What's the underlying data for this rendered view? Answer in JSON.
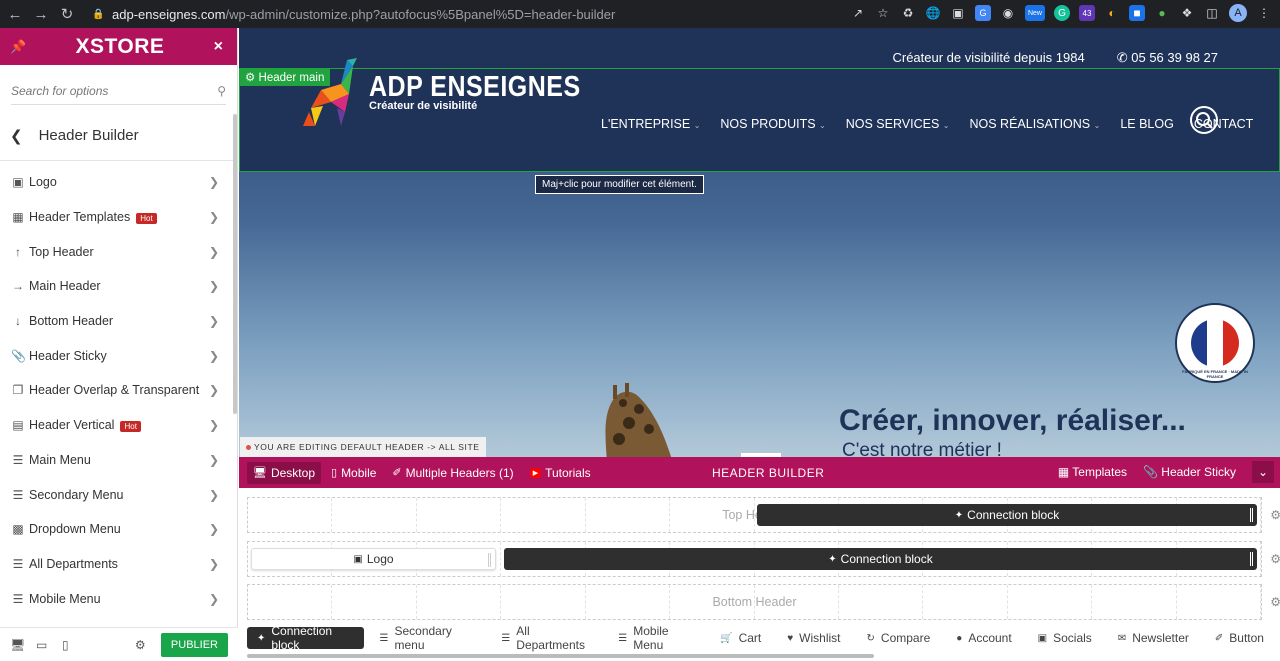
{
  "browser": {
    "url_host": "adp-enseignes.com",
    "url_path": "/wp-admin/customize.php?autofocus%5Bpanel%5D=header-builder",
    "profile_initial": "A",
    "ext_badge": "43",
    "new_badge": "New"
  },
  "sidebar": {
    "brand": "XSTORE",
    "search_placeholder": "Search for options",
    "panel_title": "Header Builder",
    "hot_label": "Hot",
    "items": [
      {
        "label": "Logo",
        "icon": "image-icon"
      },
      {
        "label": "Header Templates",
        "icon": "templates-icon",
        "hot": true
      },
      {
        "label": "Top Header",
        "icon": "arrow-up-icon"
      },
      {
        "label": "Main Header",
        "icon": "arrow-right-icon"
      },
      {
        "label": "Bottom Header",
        "icon": "arrow-down-icon"
      },
      {
        "label": "Header Sticky",
        "icon": "paperclip-icon"
      },
      {
        "label": "Header Overlap & Transparent",
        "icon": "layers-icon"
      },
      {
        "label": "Header Vertical",
        "icon": "document-icon",
        "hot": true
      },
      {
        "label": "Main Menu",
        "icon": "menu-icon"
      },
      {
        "label": "Secondary Menu",
        "icon": "menu-icon"
      },
      {
        "label": "Dropdown Menu",
        "icon": "dropdown-icon"
      },
      {
        "label": "All Departments",
        "icon": "menu-icon"
      },
      {
        "label": "Mobile Menu",
        "icon": "menu-icon"
      }
    ],
    "publish_label": "PUBLIER"
  },
  "preview": {
    "tagline": "Créateur de visibilité depuis 1984",
    "phone": "05 56 39 98 27",
    "header_main_label": "Header main",
    "logo_name": "ADP ENSEIGNES",
    "logo_sub": "Créateur de visibilité",
    "nav": [
      {
        "label": "L'ENTREPRISE",
        "dropdown": true
      },
      {
        "label": "NOS PRODUITS",
        "dropdown": true
      },
      {
        "label": "NOS SERVICES",
        "dropdown": true
      },
      {
        "label": "NOS RÉALISATIONS",
        "dropdown": true
      },
      {
        "label": "LE BLOG",
        "dropdown": false
      },
      {
        "label": "CONTACT",
        "dropdown": false
      }
    ],
    "tooltip": "Maj+clic pour modifier cet élément.",
    "hero_title": "Créer, innover, réaliser...",
    "hero_subtitle": "C'est notre métier !",
    "seal_text": "FABRIQUÉ EN FRANCE · MADE IN FRANCE",
    "editing_note": "YOU ARE EDITING DEFAULT HEADER -> ALL SITE"
  },
  "builder": {
    "title": "HEADER BUILDER",
    "tabs": [
      {
        "label": "Desktop",
        "icon": "desktop-icon",
        "active": true
      },
      {
        "label": "Mobile",
        "icon": "mobile-icon",
        "active": false
      },
      {
        "label": "Multiple Headers (1)",
        "icon": "multiple-headers-icon",
        "active": false
      },
      {
        "label": "Tutorials",
        "icon": "youtube-icon",
        "active": false
      }
    ],
    "right_actions": [
      {
        "label": "Templates",
        "icon": "templates-icon"
      },
      {
        "label": "Header Sticky",
        "icon": "paperclip-icon"
      }
    ],
    "rows": {
      "top": {
        "label": "Top Header",
        "block": "Connection block"
      },
      "main": {
        "logo_block": "Logo",
        "block": "Connection block"
      },
      "bottom": {
        "label": "Bottom Header"
      }
    },
    "available": [
      {
        "label": "Connection block",
        "icon": "connection-icon",
        "active": true
      },
      {
        "label": "Secondary menu",
        "icon": "menu-icon"
      },
      {
        "label": "All Departments",
        "icon": "menu-icon"
      },
      {
        "label": "Mobile Menu",
        "icon": "menu-icon"
      },
      {
        "label": "Cart",
        "icon": "cart-icon"
      },
      {
        "label": "Wishlist",
        "icon": "heart-icon"
      },
      {
        "label": "Compare",
        "icon": "compare-icon"
      },
      {
        "label": "Account",
        "icon": "account-icon"
      },
      {
        "label": "Socials",
        "icon": "facebook-icon"
      },
      {
        "label": "Newsletter",
        "icon": "envelope-icon"
      },
      {
        "label": "Button",
        "icon": "button-icon"
      }
    ]
  },
  "colors": {
    "brand": "#b0135b",
    "site_navy": "#1f3258",
    "publish_green": "#1aa54a",
    "frame_green": "#21a33f"
  }
}
